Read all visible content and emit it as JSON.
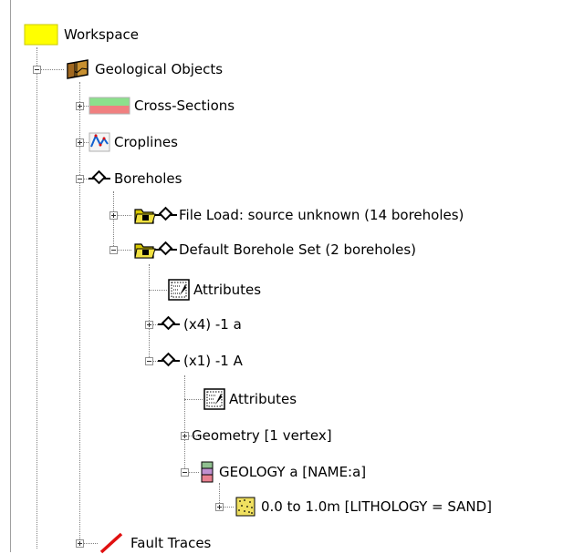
{
  "tree": {
    "workspace": "Workspace",
    "geological_objects": "Geological Objects",
    "cross_sections": "Cross-Sections",
    "croplines": "Croplines",
    "boreholes": "Boreholes",
    "file_load": "File Load: source unknown (14 boreholes)",
    "default_set": "Default Borehole Set (2 boreholes)",
    "attributes_1": "Attributes",
    "x4": "(x4) -1 a",
    "x1": "(x1) -1 A",
    "attributes_2": "Attributes",
    "geometry": "Geometry  [1 vertex]",
    "geology": "GEOLOGY a   [NAME:a]",
    "interval": "0.0 to 1.0m   [LITHOLOGY = SAND]",
    "fault_traces": "Fault Traces"
  },
  "icons": {
    "workspace": "workspace-folder-icon",
    "geological_objects": "geological-objects-icon",
    "cross_sections": "cross-sections-icon",
    "croplines": "croplines-icon",
    "boreholes": "borehole-icon",
    "borehole_set": "borehole-set-icon",
    "attributes": "attributes-icon",
    "geology": "geology-icon",
    "sand": "sand-lithology-icon",
    "fault": "fault-trace-icon"
  },
  "colors": {
    "workspace_folder": "#ffff00",
    "folder": "#d8c800",
    "cross_section_top": "#8ce08c",
    "cross_section_bottom": "#f08080",
    "fault_line": "#e01010",
    "sand": "#f0e080"
  }
}
